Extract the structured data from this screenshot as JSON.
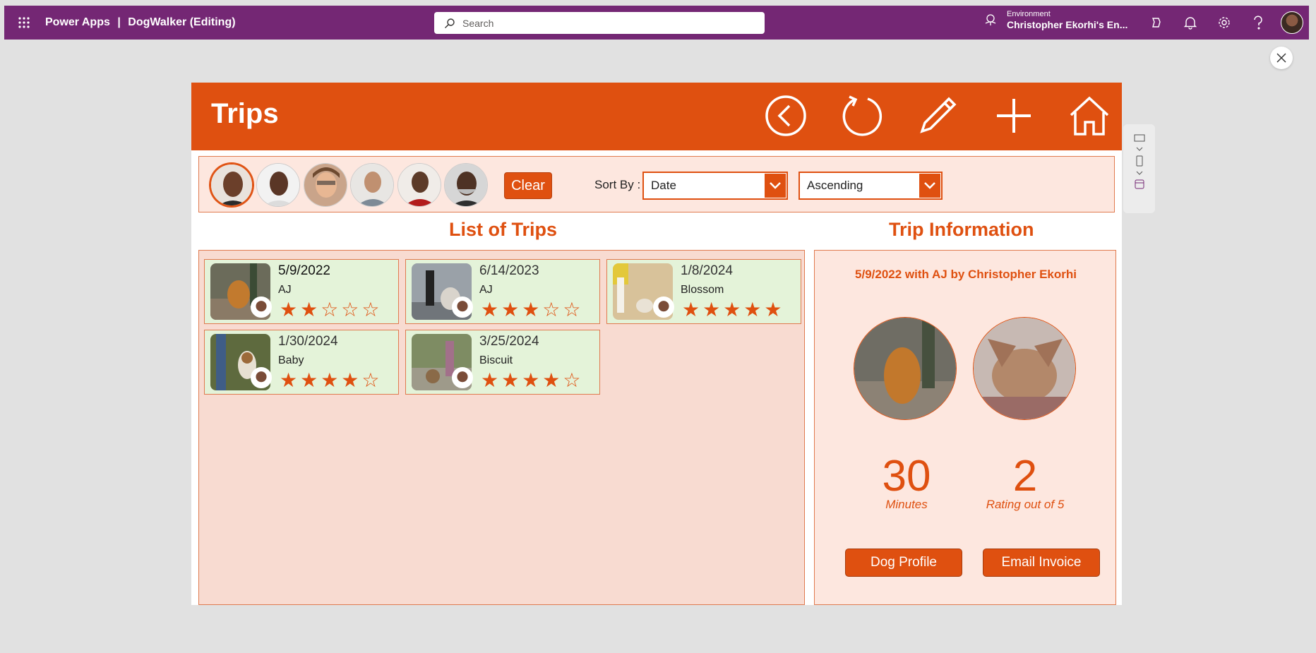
{
  "suite": {
    "app_name": "Power Apps",
    "separator": "|",
    "document": "DogWalker (Editing)",
    "search_placeholder": "Search",
    "environment_label": "Environment",
    "environment_name": "Christopher Ekorhi's En...",
    "brand_color": "#742774"
  },
  "screen": {
    "title": "Trips",
    "accent_color": "#df5010",
    "header_icons": [
      "back-icon",
      "refresh-icon",
      "edit-icon",
      "add-icon",
      "home-icon"
    ]
  },
  "filters": {
    "people_count_shown": 6,
    "clear_label": "Clear",
    "sort_label": "Sort By :",
    "sort_field": "Date",
    "sort_order": "Ascending"
  },
  "list": {
    "title": "List of Trips",
    "trips": [
      {
        "date": "5/9/2022",
        "dog": "AJ",
        "rating": 2,
        "stars": "★★☆☆☆"
      },
      {
        "date": "6/14/2023",
        "dog": "AJ",
        "rating": 3,
        "stars": "★★★☆☆"
      },
      {
        "date": "1/8/2024",
        "dog": "Blossom",
        "rating": 5,
        "stars": "★★★★★"
      },
      {
        "date": "1/30/2024",
        "dog": "Baby",
        "rating": 4,
        "stars": "★★★★☆"
      },
      {
        "date": "3/25/2024",
        "dog": "Biscuit",
        "rating": 4,
        "stars": "★★★★☆"
      }
    ]
  },
  "info": {
    "title": "Trip Information",
    "caption": "5/9/2022 with AJ by Christopher Ekorhi",
    "minutes": "30",
    "minutes_label": "Minutes",
    "rating": "2",
    "rating_label": "Rating out of 5",
    "dog_profile_label": "Dog Profile",
    "email_invoice_label": "Email Invoice"
  }
}
